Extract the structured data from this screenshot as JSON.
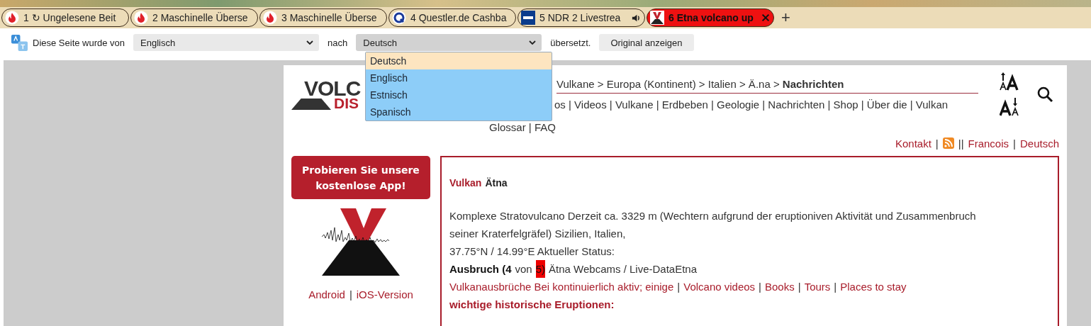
{
  "browser_tabs": [
    {
      "label": "1 ↻ Ungelesene Beit",
      "kind": "flame",
      "selected": false,
      "audio": false
    },
    {
      "label": "2 Maschinelle Überse",
      "kind": "flame",
      "selected": false,
      "audio": false
    },
    {
      "label": "3 Maschinelle Überse",
      "kind": "flame",
      "selected": false,
      "audio": false
    },
    {
      "label": "4 Questler.de Cashba",
      "kind": "q",
      "selected": false,
      "audio": false
    },
    {
      "label": "5 NDR 2 Livestrea",
      "kind": "ndr",
      "selected": false,
      "audio": true
    },
    {
      "label": "6 Etna volcano up",
      "kind": "volcano",
      "selected": true,
      "audio": false
    }
  ],
  "new_tab": "+",
  "translate_bar": {
    "label_before": "Diese Seite wurde von",
    "from_language": "Englisch",
    "label_middle": "nach",
    "to_language": "Deutsch",
    "label_after": "übersetzt.",
    "button": "Original anzeigen",
    "dropdown_options": [
      {
        "label": "Deutsch",
        "selected": true
      },
      {
        "label": "Englisch",
        "selected": false
      },
      {
        "label": "Estnisch",
        "selected": false
      },
      {
        "label": "Spanisch",
        "selected": false
      }
    ]
  },
  "header": {
    "logo_top": "VOLC",
    "logo_bottom": "DIS",
    "breadcrumb": "Vulkane > Europa (Kontinent) > Italien > Ä.na > **Nachrichten**",
    "nav_lines": [
      "os | Videos | Vulkane | Erdbeben | Geologie | Nachrichten | Shop | Über die | Vulkan",
      "Glossar | FAQ"
    ],
    "top_links": [
      {
        "kind": "link",
        "text": "Kontakt"
      },
      {
        "kind": "sep",
        "text": "|"
      },
      {
        "kind": "rss"
      },
      {
        "kind": "sep",
        "text": "||"
      },
      {
        "kind": "link",
        "text": "Francois"
      },
      {
        "kind": "sep",
        "text": "|"
      },
      {
        "kind": "link",
        "text": "Deutsch"
      }
    ]
  },
  "sidebar": {
    "app_button": "Probieren Sie unsere kostenlose App!",
    "app_links": [
      "Android",
      "iOS-Version"
    ],
    "app_link_separator": "|"
  },
  "article": {
    "title_prefix": "Vulkan",
    "title_name": "Ätna",
    "lines": [
      "Komplexe Stratovulcano Derzeit ca. 3329 m (Wechtern aufgrund der eruptioniven Aktivität und Zusammenbruch",
      "seiner Kraterfelgräfel) Sizilien, Italien,",
      "37.75°N / 14.99°E Aktueller Status:"
    ],
    "status_parts": [
      {
        "kind": "bold",
        "text": "Ausbruch (4"
      },
      {
        "kind": "plain",
        "text": "von"
      },
      {
        "kind": "highlight",
        "text": "5)"
      },
      {
        "kind": "plain",
        "text": "Ätna Webcams / Live-DataEtna"
      }
    ],
    "links": [
      "Vulkanausbrüche Bei kontinuierlich aktiv; einige",
      "Volcano videos",
      "Books",
      "Tours",
      "Places to stay"
    ],
    "link_separator": "|",
    "section_heading": "wichtige historische Eruptionen:"
  }
}
